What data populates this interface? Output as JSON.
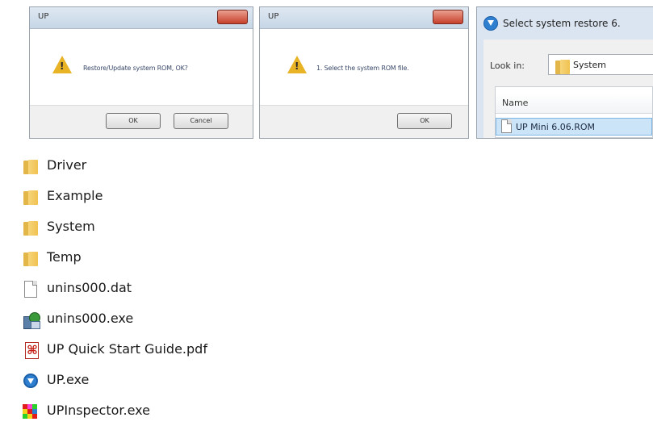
{
  "dialogs": {
    "restore_confirm": {
      "title": "UP",
      "message": "Restore/Update system ROM, OK?",
      "ok_label": "OK",
      "cancel_label": "Cancel"
    },
    "select_rom": {
      "title": "UP",
      "message": "1. Select the system ROM file.",
      "ok_label": "OK"
    },
    "file_open": {
      "title": "Select system restore 6.",
      "look_in_label": "Look in:",
      "look_in_value": "System",
      "column_name": "Name",
      "selected_file": "UP Mini 6.06.ROM"
    }
  },
  "files": [
    {
      "name": "Driver",
      "icon": "folder-icon"
    },
    {
      "name": "Example",
      "icon": "folder-icon"
    },
    {
      "name": "System",
      "icon": "folder-icon"
    },
    {
      "name": "Temp",
      "icon": "folder-icon"
    },
    {
      "name": "unins000.dat",
      "icon": "document-icon"
    },
    {
      "name": "unins000.exe",
      "icon": "installer-icon"
    },
    {
      "name": "UP Quick Start Guide.pdf",
      "icon": "pdf-icon"
    },
    {
      "name": "UP.exe",
      "icon": "up-app-icon"
    },
    {
      "name": "UPInspector.exe",
      "icon": "inspector-app-icon"
    }
  ]
}
